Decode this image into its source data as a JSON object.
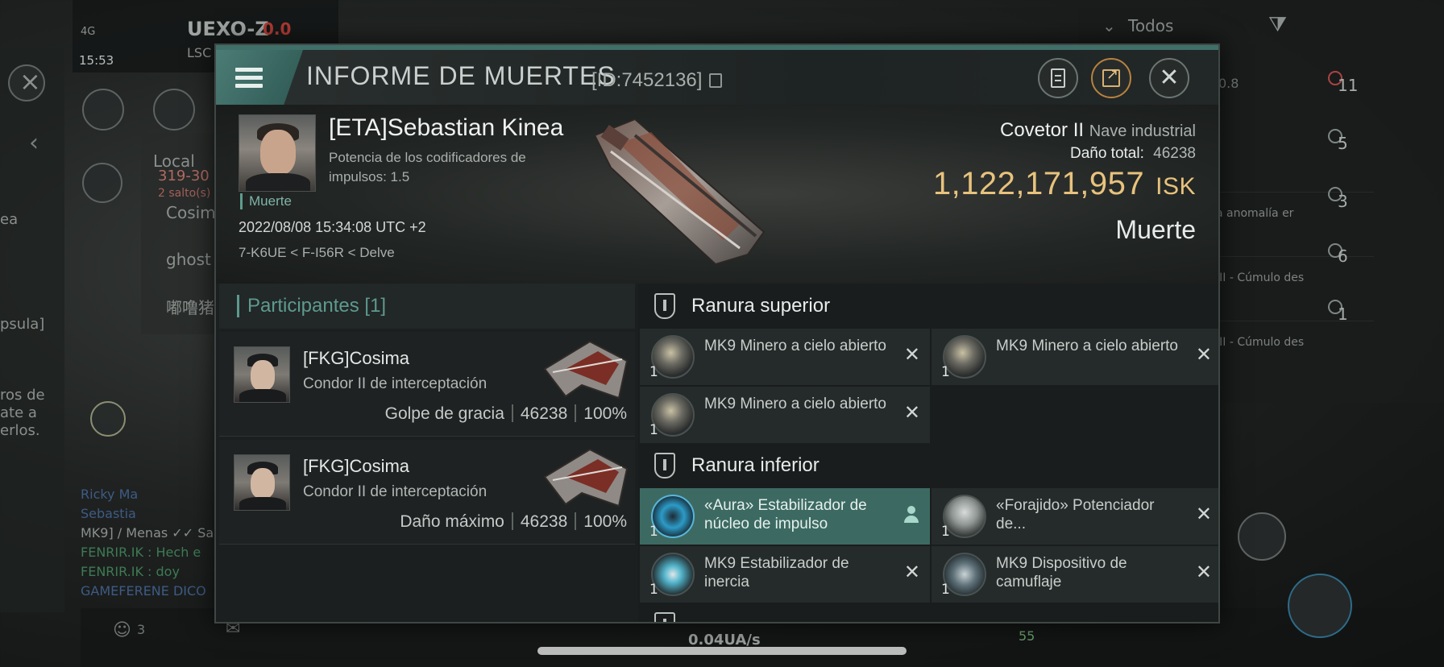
{
  "background": {
    "system_name": "UEXO-Z",
    "system_sec": "0.0",
    "system_sub": "LSC",
    "signal": "4G",
    "clock": "15:53",
    "filter_label": "Todos",
    "local_label": "Local",
    "route_text": "319-30",
    "jumps_text": "2 salto(s)",
    "chat_names": [
      "Cosim",
      "ghost",
      "嘟噜猪"
    ],
    "left_fragments": [
      "ea",
      "psula]",
      "ros de",
      "ate a",
      "erlos."
    ],
    "chat_lines": [
      "Ricky Ma",
      "Sebastia",
      "MK9] / Menas ✓✓ Sa",
      "FENRIR.IK : Hech e",
      "FENRIR.IK : doy",
      "GAMEFERENE DICO"
    ],
    "right_values": [
      "0.8",
      "11",
      "5",
      "3",
      "6",
      "1"
    ],
    "right_texts": [
      "a anomalía er",
      "III - Cúmulo des",
      "III - Cúmulo des"
    ],
    "bottom_speed": "0.04UA/s",
    "bottom_count": "55",
    "bottom_people": "3"
  },
  "killmail": {
    "title": "INFORME DE MUERTES",
    "id_label": "[ID:7452136]",
    "victim": {
      "name": "[ETA]Sebastian Kinea",
      "subtitle": "Potencia de los codificadores de impulsos: 1.5",
      "status": "Muerte",
      "datetime": "2022/08/08 15:34:08 UTC +2",
      "location": "7-K6UE < F-I56R < Delve"
    },
    "ship": {
      "name": "Covetor II",
      "class": "Nave industrial",
      "damage_label": "Daño total:",
      "damage_value": "46238",
      "isk_value": "1,122,171,957",
      "isk_unit": "ISK",
      "result": "Muerte"
    },
    "participants_label": "Participantes [1]",
    "participants": [
      {
        "name": "[FKG]Cosima",
        "ship": "Condor II de interceptación",
        "role": "Golpe de gracia",
        "damage": "46238",
        "percent": "100%"
      },
      {
        "name": "[FKG]Cosima",
        "ship": "Condor II de interceptación",
        "role": "Daño máximo",
        "damage": "46238",
        "percent": "100%"
      }
    ],
    "high_slot_label": "Ranura superior",
    "high_slots": [
      {
        "name": "MK9 Minero a cielo abierto",
        "qty": "1"
      },
      {
        "name": "MK9 Minero a cielo abierto",
        "qty": "1"
      },
      {
        "name": "MK9 Minero a cielo abierto",
        "qty": "1"
      }
    ],
    "low_slot_label": "Ranura inferior",
    "low_slots": [
      {
        "name": "«Aura» Estabilizador de núcleo de impulso",
        "qty": "1"
      },
      {
        "name": "«Forajido» Potenciador de...",
        "qty": "1"
      },
      {
        "name": "MK9 Estabilizador de inercia",
        "qty": "1"
      },
      {
        "name": "MK9 Dispositivo de camuflaje",
        "qty": "1"
      }
    ],
    "colors": {
      "accent": "#4f8079",
      "isk": "#e8c27d",
      "active_row": "#3c6a62"
    }
  }
}
